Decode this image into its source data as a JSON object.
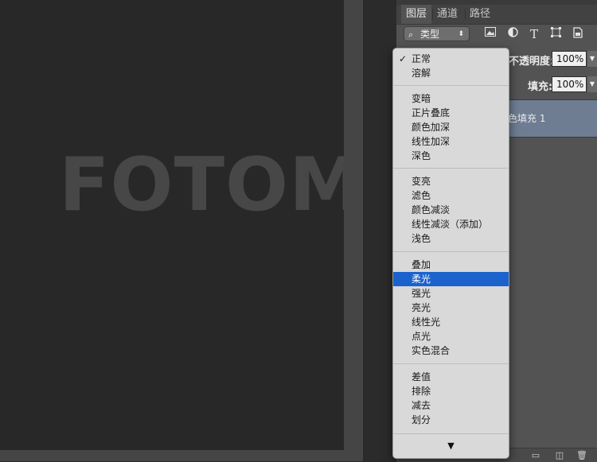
{
  "canvas": {
    "watermark": "FOTOMEN"
  },
  "layers_panel": {
    "tabs": [
      {
        "label": "图层",
        "active": true
      },
      {
        "label": "通道",
        "active": false
      },
      {
        "label": "路径",
        "active": false
      }
    ],
    "filter": {
      "label": "类型",
      "search_icon": "search-icon"
    },
    "filter_icons": [
      "image-filter-icon",
      "adjustment-filter-icon",
      "type-filter-icon",
      "shape-filter-icon",
      "smart-object-filter-icon"
    ],
    "opacity": {
      "label": "不透明度:",
      "value": "100%"
    },
    "fill": {
      "label": "填充:",
      "value": "100%"
    },
    "layer": {
      "name": "色填充 1"
    }
  },
  "blend_menu": {
    "groups": [
      [
        "正常",
        "溶解"
      ],
      [
        "变暗",
        "正片叠底",
        "颜色加深",
        "线性加深",
        "深色"
      ],
      [
        "变亮",
        "滤色",
        "颜色减淡",
        "线性减淡（添加）",
        "浅色"
      ],
      [
        "叠加",
        "柔光",
        "强光",
        "亮光",
        "线性光",
        "点光",
        "实色混合"
      ],
      [
        "差值",
        "排除",
        "减去",
        "划分"
      ]
    ],
    "checked": "正常",
    "selected": "柔光",
    "more_arrow": "▼"
  },
  "colors": {
    "selection": "#1b62cc",
    "layer_highlight": "#6e7d92"
  }
}
